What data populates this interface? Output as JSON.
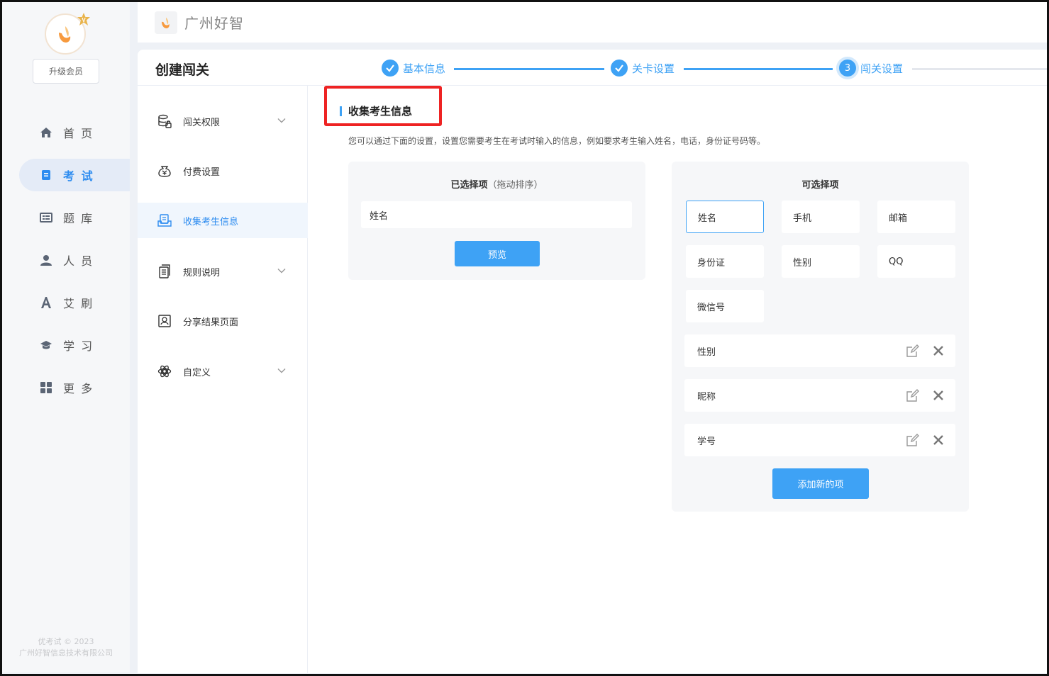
{
  "sidebar": {
    "upgrade_label": "升级会员",
    "items": [
      {
        "label": "首 页",
        "icon": "home-icon"
      },
      {
        "label": "考 试",
        "icon": "exam-icon",
        "active": true
      },
      {
        "label": "题 库",
        "icon": "question-bank-icon"
      },
      {
        "label": "人 员",
        "icon": "person-icon"
      },
      {
        "label": "艾 刷",
        "icon": "letter-a-icon"
      },
      {
        "label": "学 习",
        "icon": "graduation-cap-icon"
      },
      {
        "label": "更 多",
        "icon": "grid-icon"
      }
    ],
    "footer_line1": "优考试 © 2023",
    "footer_line2": "广州好智信息技术有限公司"
  },
  "header": {
    "brand": "广州好智"
  },
  "page": {
    "title": "创建闯关",
    "steps": [
      {
        "label": "基本信息",
        "state": "done"
      },
      {
        "label": "关卡设置",
        "state": "done"
      },
      {
        "label": "闯关设置",
        "state": "current",
        "number": "3"
      }
    ]
  },
  "submenu": {
    "items": [
      {
        "label": "闯关权限",
        "icon": "permission-icon",
        "has_chevron": true
      },
      {
        "label": "付费设置",
        "icon": "payment-icon",
        "has_chevron": false
      },
      {
        "label": "收集考生信息",
        "icon": "collect-info-icon",
        "has_chevron": false,
        "active": true
      },
      {
        "label": "规则说明",
        "icon": "rules-icon",
        "has_chevron": true
      },
      {
        "label": "分享结果页面",
        "icon": "share-result-icon",
        "has_chevron": false
      },
      {
        "label": "自定义",
        "icon": "custom-icon",
        "has_chevron": true
      }
    ]
  },
  "content": {
    "section_title": "收集考生信息",
    "description": "您可以通过下面的设置，设置您需要考生在考试时输入的信息，例如要求考生输入姓名，电话，身份证号码等。",
    "selected": {
      "title": "已选择项",
      "hint": "（拖动排序）",
      "fields": [
        "姓名"
      ],
      "preview_label": "预览"
    },
    "options": {
      "title": "可选择项",
      "items": [
        {
          "label": "姓名",
          "selected": true
        },
        {
          "label": "手机",
          "selected": false
        },
        {
          "label": "邮箱",
          "selected": false
        },
        {
          "label": "身份证",
          "selected": false
        },
        {
          "label": "性别",
          "selected": false
        },
        {
          "label": "QQ",
          "selected": false
        },
        {
          "label": "微信号",
          "selected": false
        }
      ],
      "custom": [
        {
          "label": "性别"
        },
        {
          "label": "昵称"
        },
        {
          "label": "学号"
        }
      ],
      "add_label": "添加新的项"
    }
  },
  "colors": {
    "accent": "#3ea2f5",
    "highlight": "#ee2323"
  }
}
